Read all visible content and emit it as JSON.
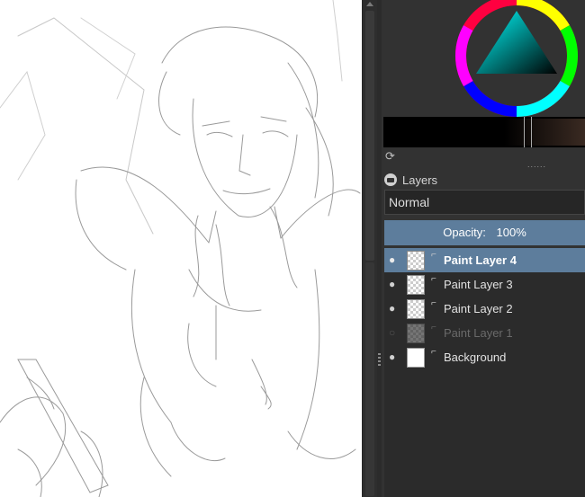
{
  "layers_panel": {
    "title": "Layers",
    "blend_mode": "Normal",
    "opacity_label": "Opacity:",
    "opacity_value": "100%",
    "handle_dots": "......",
    "layers": [
      {
        "name": "Paint Layer 4",
        "visible": true,
        "selected": true
      },
      {
        "name": "Paint Layer 3",
        "visible": true,
        "selected": false
      },
      {
        "name": "Paint Layer 2",
        "visible": true,
        "selected": false
      },
      {
        "name": "Paint Layer 1",
        "visible": false,
        "selected": false
      },
      {
        "name": "Background",
        "visible": true,
        "selected": false
      }
    ]
  },
  "icons": {
    "eye": "eye-icon",
    "eye_hidden": "eye-hidden-icon",
    "paint_layer": "paint-layer-icon",
    "refresh": "refresh-icon",
    "layers": "layers-icon"
  },
  "colors": {
    "accent": "#5d7d9c",
    "panel_bg": "#323232",
    "list_bg": "#2b2b2b"
  }
}
